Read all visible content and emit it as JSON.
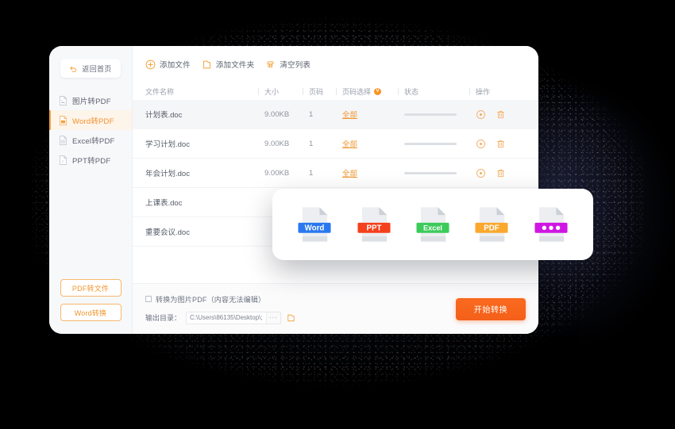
{
  "window": {
    "sidebar": {
      "back_button": {
        "label": "返回首页",
        "icon": "undo-arrow-icon"
      },
      "items": [
        {
          "label": "图片转PDF",
          "icon": "image-file-icon",
          "active": false
        },
        {
          "label": "Word转PDF",
          "icon": "word-file-icon",
          "active": true
        },
        {
          "label": "Excel转PDF",
          "icon": "excel-file-icon",
          "active": false
        },
        {
          "label": "PPT转PDF",
          "icon": "ppt-file-icon",
          "active": false
        }
      ],
      "actions": [
        {
          "label": "PDF转文件"
        },
        {
          "label": "Word转换"
        }
      ]
    },
    "toolbar": [
      {
        "label": "添加文件",
        "icon": "plus-circle-icon"
      },
      {
        "label": "添加文件夹",
        "icon": "folder-icon"
      },
      {
        "label": "清空列表",
        "icon": "broom-icon"
      }
    ],
    "table": {
      "columns": {
        "name": "文件名称",
        "size": "大小",
        "pages": "页码",
        "page_select": "页码选择",
        "page_select_badge": "V",
        "status": "状态",
        "action": "操作"
      },
      "rows": [
        {
          "name": "计划表.doc",
          "size": "9.00KB",
          "pages": "1",
          "page_select": "全部",
          "highlight": true
        },
        {
          "name": "学习计划.doc",
          "size": "9.00KB",
          "pages": "1",
          "page_select": "全部",
          "highlight": false
        },
        {
          "name": "年会计划.doc",
          "size": "9.00KB",
          "pages": "1",
          "page_select": "全部",
          "highlight": false
        },
        {
          "name": "上课表.doc",
          "size": "",
          "pages": "",
          "page_select": "",
          "highlight": false
        },
        {
          "name": "重要会议.doc",
          "size": "",
          "pages": "",
          "page_select": "",
          "highlight": false
        }
      ],
      "row_actions": {
        "start": "play-circle-icon",
        "delete": "trash-icon"
      }
    },
    "footer": {
      "image_pdf_checkbox": {
        "label": "转换为图片PDF（内容无法编辑）",
        "checked": false
      },
      "output_dir_label": "输出目录：",
      "output_dir_value": "C:\\Users\\86135\\Desktop\\;",
      "browse_dots": "···",
      "folder_icon": "folder-open-icon",
      "convert_button": "开始转换"
    }
  },
  "file_type_card": {
    "icons": [
      {
        "label": "Word",
        "color": "#2a78f0",
        "name": "word-file-icon"
      },
      {
        "label": "PPT",
        "color": "#f4401c",
        "name": "ppt-file-icon"
      },
      {
        "label": "Excel",
        "color": "#3ccb5b",
        "name": "excel-file-icon"
      },
      {
        "label": "PDF",
        "color": "#fba82e",
        "name": "pdf-file-icon"
      },
      {
        "label": "•••",
        "color": "#cf16e2",
        "name": "other-file-icon"
      }
    ]
  },
  "colors": {
    "accent_orange": "#f0962f",
    "convert_orange": "#f4601a",
    "active_bg": "#fdf4ea",
    "background": "#000000"
  }
}
